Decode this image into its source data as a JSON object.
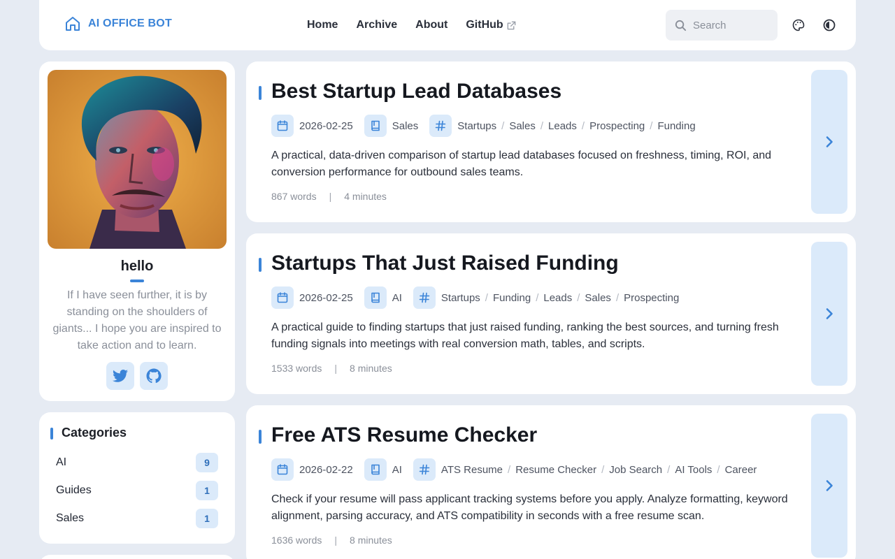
{
  "header": {
    "brand": "AI OFFICE BOT",
    "brand_icon": "home-icon",
    "nav": [
      {
        "label": "Home"
      },
      {
        "label": "Archive"
      },
      {
        "label": "About"
      },
      {
        "label": "GitHub",
        "icon": "external-link-icon"
      }
    ],
    "search_placeholder": "Search",
    "actions": [
      "palette-icon",
      "theme-toggle-icon"
    ]
  },
  "profile": {
    "name": "hello",
    "bio": "If I have seen further, it is by standing on the shoulders of giants... I hope you are inspired to take action and to learn.",
    "socials": [
      "twitter-icon",
      "github-icon"
    ]
  },
  "categories": {
    "title": "Categories",
    "items": [
      {
        "label": "AI",
        "count": "9"
      },
      {
        "label": "Guides",
        "count": "1"
      },
      {
        "label": "Sales",
        "count": "1"
      }
    ]
  },
  "posts": [
    {
      "title": "Best Startup Lead Databases",
      "date": "2026-02-25",
      "category": "Sales",
      "tags": [
        "Startups",
        "Sales",
        "Leads",
        "Prospecting",
        "Funding"
      ],
      "description": "A practical, data-driven comparison of startup lead databases focused on freshness, timing, ROI, and conversion performance for outbound sales teams.",
      "words": "867 words",
      "read_time": "4 minutes"
    },
    {
      "title": "Startups That Just Raised Funding",
      "date": "2026-02-25",
      "category": "AI",
      "tags": [
        "Startups",
        "Funding",
        "Leads",
        "Sales",
        "Prospecting"
      ],
      "description": "A practical guide to finding startups that just raised funding, ranking the best sources, and turning fresh funding signals into meetings with real conversion math, tables, and scripts.",
      "words": "1533 words",
      "read_time": "8 minutes"
    },
    {
      "title": "Free ATS Resume Checker",
      "date": "2026-02-22",
      "category": "AI",
      "tags": [
        "ATS Resume",
        "Resume Checker",
        "Job Search",
        "AI Tools",
        "Career"
      ],
      "description": "Check if your resume will pass applicant tracking systems before you apply. Analyze formatting, keyword alignment, parsing accuracy, and ATS compatibility in seconds with a free resume scan.",
      "words": "1636 words",
      "read_time": "8 minutes"
    }
  ],
  "colors": {
    "accent": "#3b84d8",
    "accent_light": "#dbeafa",
    "background": "#e6ebf3",
    "card": "#ffffff"
  }
}
